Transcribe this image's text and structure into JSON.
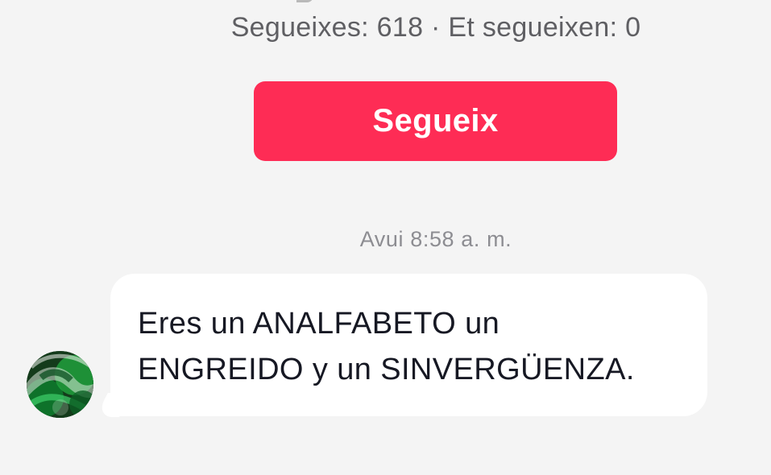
{
  "profile": {
    "follow_stats": "Segueixes: 618 · Et segueixen: 0",
    "follow_button_label": "Segueix"
  },
  "chat": {
    "timestamp": "Avui 8:58 a. m.",
    "messages": [
      {
        "text": "Eres un ANALFABETO un\nENGREIDO y un SINVERGÜENZA.",
        "avatar_icon": "green-abstract-avatar"
      }
    ]
  },
  "colors": {
    "background": "#f4f4f4",
    "accent": "#fe2c55",
    "bubble": "#ffffff",
    "secondary_text": "#5f5f63",
    "timestamp_text": "#8d8d92"
  }
}
